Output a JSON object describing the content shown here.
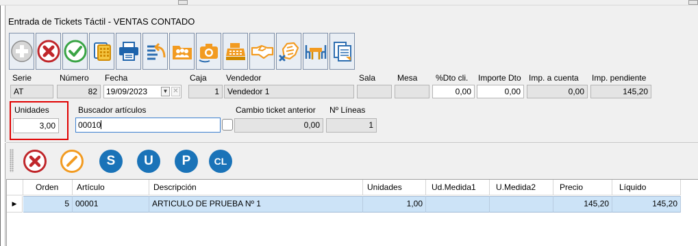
{
  "window": {
    "title": "Entrada de Tickets Táctil - VENTAS CONTADO"
  },
  "toolbar": {
    "buttons": [
      {
        "name": "add",
        "icon": "plus-circle-icon"
      },
      {
        "name": "delete",
        "icon": "red-x-icon"
      },
      {
        "name": "confirm",
        "icon": "green-check-icon"
      },
      {
        "name": "calculator",
        "icon": "calculator-icon"
      },
      {
        "name": "print",
        "icon": "printer-icon"
      },
      {
        "name": "return",
        "icon": "undo-list-icon"
      },
      {
        "name": "customers",
        "icon": "people-folder-icon"
      },
      {
        "name": "photo",
        "icon": "camera-icon"
      },
      {
        "name": "cash-register",
        "icon": "cash-register-icon"
      },
      {
        "name": "handshake",
        "icon": "handshake-icon"
      },
      {
        "name": "cancel-deal",
        "icon": "hand-cancel-icon"
      },
      {
        "name": "table",
        "icon": "table-chairs-icon"
      },
      {
        "name": "documents",
        "icon": "documents-icon"
      }
    ]
  },
  "header": {
    "serie_label": "Serie",
    "serie_value": "AT",
    "numero_label": "Número",
    "numero_value": "82",
    "fecha_label": "Fecha",
    "fecha_value": "19/09/2023",
    "caja_label": "Caja",
    "caja_value": "1",
    "vendedor_label": "Vendedor",
    "vendedor_value": "Vendedor 1",
    "sala_label": "Sala",
    "sala_value": "",
    "mesa_label": "Mesa",
    "mesa_value": "",
    "dto_cli_label": "%Dto cli.",
    "dto_cli_value": "0,00",
    "importe_dto_label": "Importe Dto",
    "importe_dto_value": "0,00",
    "imp_cuenta_label": "Imp. a cuenta",
    "imp_cuenta_value": "0,00",
    "imp_pendiente_label": "Imp. pendiente",
    "imp_pendiente_value": "145,20"
  },
  "entry": {
    "unidades_label": "Unidades",
    "unidades_value": "3,00",
    "buscador_label": "Buscador artículos",
    "buscador_value": "00010",
    "cambio_label": "Cambio ticket anterior",
    "cambio_value": "0,00",
    "lineas_label": "Nº Líneas",
    "lineas_value": "1"
  },
  "line_actions": [
    {
      "name": "delete-line",
      "label": "",
      "color": "#c0262a"
    },
    {
      "name": "edit-line",
      "label": "",
      "color": "#f29b21"
    },
    {
      "name": "s",
      "label": "S",
      "color": "#1a73b8"
    },
    {
      "name": "u",
      "label": "U",
      "color": "#1a73b8"
    },
    {
      "name": "p",
      "label": "P",
      "color": "#1a73b8"
    },
    {
      "name": "cl",
      "label": "CL",
      "color": "#1a73b8"
    }
  ],
  "grid": {
    "columns": [
      "Orden",
      "Artículo",
      "Descripción",
      "Unidades",
      "Ud.Medida1",
      "U.Medida2",
      "Precio",
      "Líquido"
    ],
    "rows": [
      {
        "orden": "5",
        "articulo": "00001",
        "descripcion": "ARTICULO DE PRUEBA Nº 1",
        "unidades": "1,00",
        "ud_medida1": "",
        "u_medida2": "",
        "precio": "145,20",
        "liquido": "145,20"
      }
    ],
    "current_row_marker": "▶"
  },
  "colors": {
    "highlight_border": "#e00000",
    "selected_row": "#cce3f7",
    "action_blue": "#1a73b8"
  }
}
